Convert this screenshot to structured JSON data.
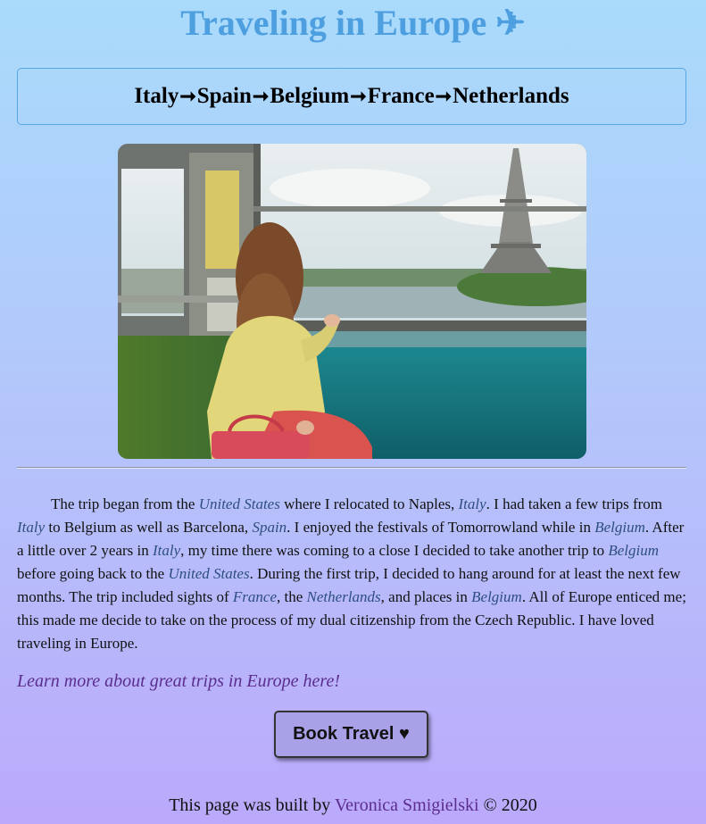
{
  "header": {
    "title": "Traveling in Europe",
    "title_icon": "airplane-icon",
    "title_icon_char": "✈"
  },
  "route": {
    "stops": [
      "Italy",
      "Spain",
      "Belgium",
      "France",
      "Netherlands"
    ],
    "separator": "➞"
  },
  "photo": {
    "icon": "photo-woman-train-eiffel-tower"
  },
  "story": {
    "p1": "The trip began from the ",
    "l1": "United States",
    "p2": " where I relocated to Naples, ",
    "l2": "Italy",
    "p3": ". I had taken a few trips from ",
    "l3": "Italy",
    "p4": " to Belgium as well as Barcelona, ",
    "l4": "Spain",
    "p5": ". I enjoyed the festivals of Tomorrowland while in ",
    "l5": "Belgium",
    "p6": ". After a little over 2 years in ",
    "l6": "Italy",
    "p7": ", my time there was coming to a close I decided to take another trip to ",
    "l7": "Belgium",
    "p8": " before going back to the ",
    "l8": "United States",
    "p9": ". During the first trip, I decided to hang around for at least the next few months. The trip included sights of ",
    "l9": "France",
    "p10": ", the ",
    "l10": "Netherlands",
    "p11": ", and places in ",
    "l11": "Belgium",
    "p12": ". All of Europe enticed me; this made me decide to take on the process of my dual citizenship from the Czech Republic. I have loved traveling in Europe."
  },
  "learn_more": {
    "label": "Learn more about great trips in Europe here!"
  },
  "book_button": {
    "label": "Book Travel ♥"
  },
  "footer": {
    "prefix": "This page was built by ",
    "author": "Veronica Smigielski",
    "suffix": " © 2020"
  },
  "colors": {
    "title": "#4e9fe0",
    "link_italic": "#2e4f7e",
    "learn_link": "#5b2d8e",
    "button_bg": "#a9a1e8"
  }
}
